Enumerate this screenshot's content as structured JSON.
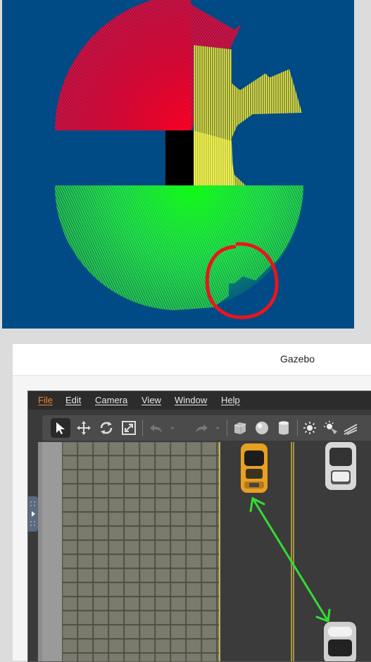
{
  "window": {
    "title": "Gazebo"
  },
  "menu": [
    {
      "label": "File",
      "active": true
    },
    {
      "label": "Edit"
    },
    {
      "label": "Camera"
    },
    {
      "label": "View"
    },
    {
      "label": "Window"
    },
    {
      "label": "Help"
    }
  ],
  "toolbar": [
    {
      "icon": "select-arrow-icon"
    },
    {
      "icon": "translate-icon"
    },
    {
      "icon": "rotate-icon"
    },
    {
      "icon": "scale-icon"
    },
    {
      "icon": "undo-icon"
    },
    {
      "icon": "undo-dropdown-icon"
    },
    {
      "icon": "redo-icon"
    },
    {
      "icon": "redo-dropdown-icon"
    },
    {
      "icon": "box-shape-icon"
    },
    {
      "icon": "sphere-shape-icon"
    },
    {
      "icon": "cylinder-shape-icon"
    },
    {
      "icon": "point-light-icon"
    },
    {
      "icon": "spot-light-icon"
    },
    {
      "icon": "directional-light-icon"
    }
  ],
  "colors": {
    "lidar_background": "#004a85",
    "sector_red": "#ff0030",
    "sector_yellow": "#ffff40",
    "sector_green": "#20ff20",
    "highlight_circle": "#e8161c",
    "menu_active": "#f0822e",
    "annotation_arrow": "#33dd33"
  }
}
